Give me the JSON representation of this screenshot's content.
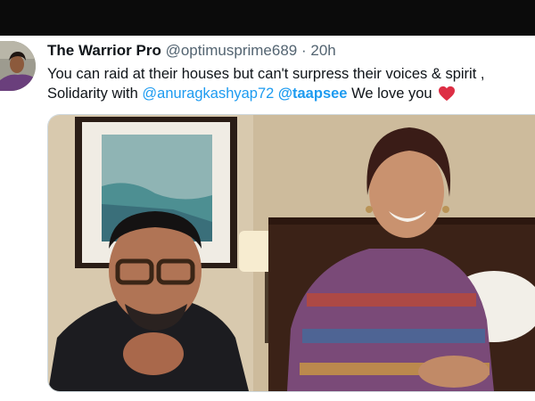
{
  "tweet": {
    "display_name": "The Warrior Pro",
    "handle": "@optimusprime689",
    "separator": "·",
    "timestamp": "20h",
    "text_line1": "You can raid at their houses but can't surpress their voices & spirit ,",
    "text_prefix": "Solidarity with",
    "mention1": "@anuragkashyap72",
    "mention2": "@taapsee",
    "text_suffix": "We love you",
    "emoji": "heart-icon"
  },
  "colors": {
    "text": "#0f1419",
    "secondary": "#536471",
    "link": "#1d9bf0",
    "heart": "#f91880",
    "topbar": "#0b0b0b"
  }
}
